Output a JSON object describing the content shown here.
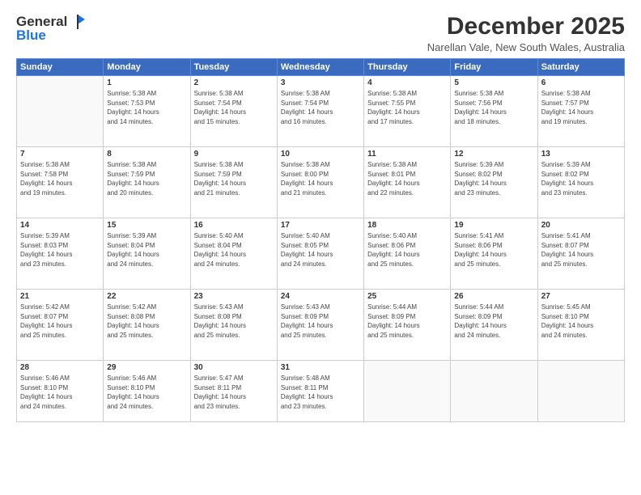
{
  "header": {
    "logo_general": "General",
    "logo_blue": "Blue",
    "month_title": "December 2025",
    "location": "Narellan Vale, New South Wales, Australia"
  },
  "weekdays": [
    "Sunday",
    "Monday",
    "Tuesday",
    "Wednesday",
    "Thursday",
    "Friday",
    "Saturday"
  ],
  "weeks": [
    [
      {
        "day": "",
        "info": ""
      },
      {
        "day": "1",
        "info": "Sunrise: 5:38 AM\nSunset: 7:53 PM\nDaylight: 14 hours\nand 14 minutes."
      },
      {
        "day": "2",
        "info": "Sunrise: 5:38 AM\nSunset: 7:54 PM\nDaylight: 14 hours\nand 15 minutes."
      },
      {
        "day": "3",
        "info": "Sunrise: 5:38 AM\nSunset: 7:54 PM\nDaylight: 14 hours\nand 16 minutes."
      },
      {
        "day": "4",
        "info": "Sunrise: 5:38 AM\nSunset: 7:55 PM\nDaylight: 14 hours\nand 17 minutes."
      },
      {
        "day": "5",
        "info": "Sunrise: 5:38 AM\nSunset: 7:56 PM\nDaylight: 14 hours\nand 18 minutes."
      },
      {
        "day": "6",
        "info": "Sunrise: 5:38 AM\nSunset: 7:57 PM\nDaylight: 14 hours\nand 19 minutes."
      }
    ],
    [
      {
        "day": "7",
        "info": "Sunrise: 5:38 AM\nSunset: 7:58 PM\nDaylight: 14 hours\nand 19 minutes."
      },
      {
        "day": "8",
        "info": "Sunrise: 5:38 AM\nSunset: 7:59 PM\nDaylight: 14 hours\nand 20 minutes."
      },
      {
        "day": "9",
        "info": "Sunrise: 5:38 AM\nSunset: 7:59 PM\nDaylight: 14 hours\nand 21 minutes."
      },
      {
        "day": "10",
        "info": "Sunrise: 5:38 AM\nSunset: 8:00 PM\nDaylight: 14 hours\nand 21 minutes."
      },
      {
        "day": "11",
        "info": "Sunrise: 5:38 AM\nSunset: 8:01 PM\nDaylight: 14 hours\nand 22 minutes."
      },
      {
        "day": "12",
        "info": "Sunrise: 5:39 AM\nSunset: 8:02 PM\nDaylight: 14 hours\nand 23 minutes."
      },
      {
        "day": "13",
        "info": "Sunrise: 5:39 AM\nSunset: 8:02 PM\nDaylight: 14 hours\nand 23 minutes."
      }
    ],
    [
      {
        "day": "14",
        "info": "Sunrise: 5:39 AM\nSunset: 8:03 PM\nDaylight: 14 hours\nand 23 minutes."
      },
      {
        "day": "15",
        "info": "Sunrise: 5:39 AM\nSunset: 8:04 PM\nDaylight: 14 hours\nand 24 minutes."
      },
      {
        "day": "16",
        "info": "Sunrise: 5:40 AM\nSunset: 8:04 PM\nDaylight: 14 hours\nand 24 minutes."
      },
      {
        "day": "17",
        "info": "Sunrise: 5:40 AM\nSunset: 8:05 PM\nDaylight: 14 hours\nand 24 minutes."
      },
      {
        "day": "18",
        "info": "Sunrise: 5:40 AM\nSunset: 8:06 PM\nDaylight: 14 hours\nand 25 minutes."
      },
      {
        "day": "19",
        "info": "Sunrise: 5:41 AM\nSunset: 8:06 PM\nDaylight: 14 hours\nand 25 minutes."
      },
      {
        "day": "20",
        "info": "Sunrise: 5:41 AM\nSunset: 8:07 PM\nDaylight: 14 hours\nand 25 minutes."
      }
    ],
    [
      {
        "day": "21",
        "info": "Sunrise: 5:42 AM\nSunset: 8:07 PM\nDaylight: 14 hours\nand 25 minutes."
      },
      {
        "day": "22",
        "info": "Sunrise: 5:42 AM\nSunset: 8:08 PM\nDaylight: 14 hours\nand 25 minutes."
      },
      {
        "day": "23",
        "info": "Sunrise: 5:43 AM\nSunset: 8:08 PM\nDaylight: 14 hours\nand 25 minutes."
      },
      {
        "day": "24",
        "info": "Sunrise: 5:43 AM\nSunset: 8:09 PM\nDaylight: 14 hours\nand 25 minutes."
      },
      {
        "day": "25",
        "info": "Sunrise: 5:44 AM\nSunset: 8:09 PM\nDaylight: 14 hours\nand 25 minutes."
      },
      {
        "day": "26",
        "info": "Sunrise: 5:44 AM\nSunset: 8:09 PM\nDaylight: 14 hours\nand 24 minutes."
      },
      {
        "day": "27",
        "info": "Sunrise: 5:45 AM\nSunset: 8:10 PM\nDaylight: 14 hours\nand 24 minutes."
      }
    ],
    [
      {
        "day": "28",
        "info": "Sunrise: 5:46 AM\nSunset: 8:10 PM\nDaylight: 14 hours\nand 24 minutes."
      },
      {
        "day": "29",
        "info": "Sunrise: 5:46 AM\nSunset: 8:10 PM\nDaylight: 14 hours\nand 24 minutes."
      },
      {
        "day": "30",
        "info": "Sunrise: 5:47 AM\nSunset: 8:11 PM\nDaylight: 14 hours\nand 23 minutes."
      },
      {
        "day": "31",
        "info": "Sunrise: 5:48 AM\nSunset: 8:11 PM\nDaylight: 14 hours\nand 23 minutes."
      },
      {
        "day": "",
        "info": ""
      },
      {
        "day": "",
        "info": ""
      },
      {
        "day": "",
        "info": ""
      }
    ]
  ]
}
